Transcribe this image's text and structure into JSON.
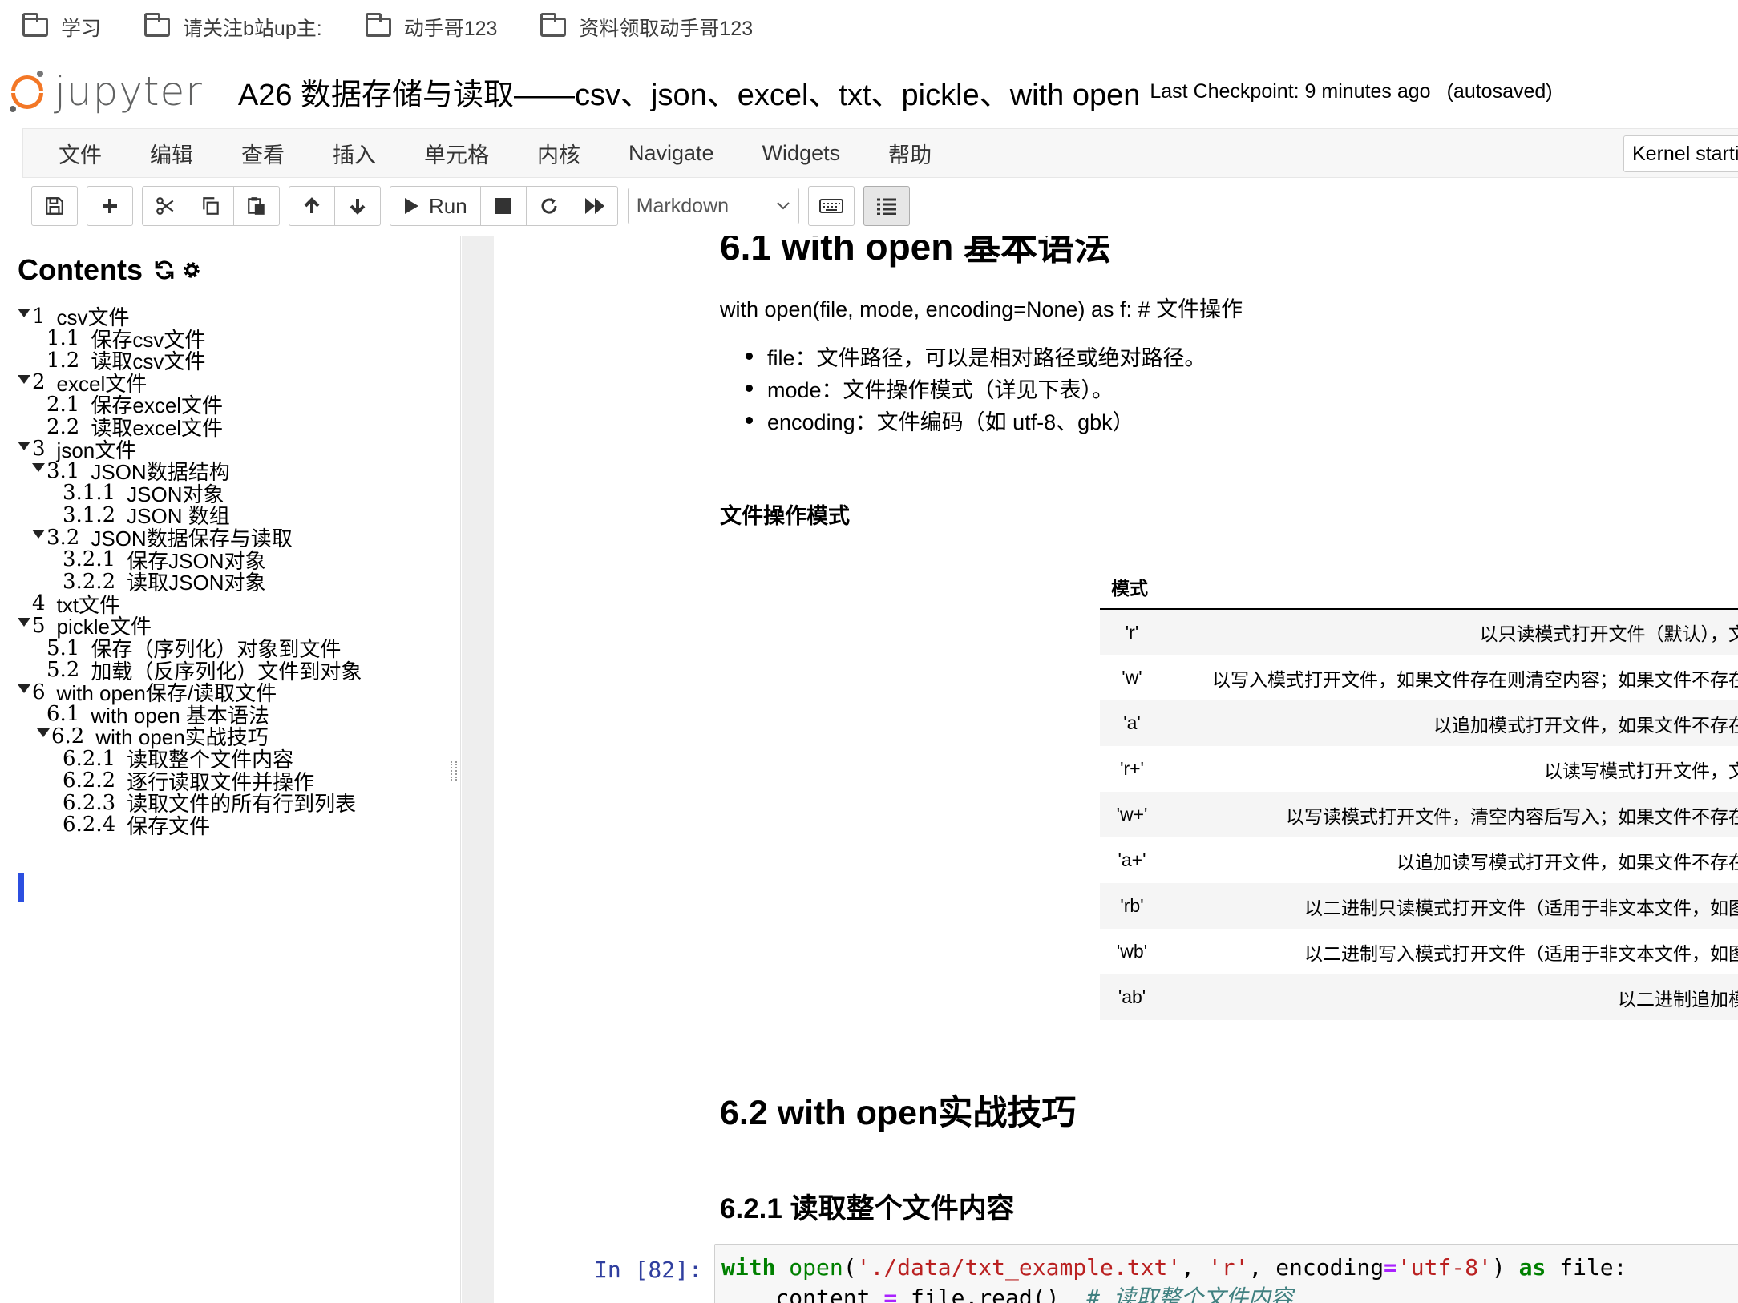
{
  "bookmarks": [
    "学习",
    "请关注b站up主:",
    "动手哥123",
    "资料领取动手哥123"
  ],
  "header": {
    "logo_text": "jupyter",
    "title": "A26 数据存储与读取——csv、json、excel、txt、pickle、with open",
    "checkpoint": "Last Checkpoint: 9 minutes ago",
    "autosaved": "(autosaved)"
  },
  "menu": [
    "文件",
    "编辑",
    "查看",
    "插入",
    "单元格",
    "内核",
    "Navigate",
    "Widgets",
    "帮助"
  ],
  "kernel_status": "Kernel starting",
  "toolbar": {
    "run_label": "Run",
    "cell_type": "Markdown",
    "icons": [
      "save-icon",
      "plus-icon",
      "scissors-icon",
      "copy-icon",
      "paste-icon",
      "arrow-up-icon",
      "arrow-down-icon",
      "play-icon",
      "stop-icon",
      "restart-icon",
      "fast-forward-icon",
      "keyboard-icon",
      "list-icon"
    ]
  },
  "toc": {
    "title": "Contents",
    "items": [
      {
        "num": "1",
        "label": "csv文件",
        "level": 1,
        "collapsible": true
      },
      {
        "num": "1.1",
        "label": "保存csv文件",
        "level": 2,
        "collapsible": false
      },
      {
        "num": "1.2",
        "label": "读取csv文件",
        "level": 2,
        "collapsible": false
      },
      {
        "num": "2",
        "label": "excel文件",
        "level": 1,
        "collapsible": true
      },
      {
        "num": "2.1",
        "label": "保存excel文件",
        "level": 2,
        "collapsible": false
      },
      {
        "num": "2.2",
        "label": "读取excel文件",
        "level": 2,
        "collapsible": false
      },
      {
        "num": "3",
        "label": "json文件",
        "level": 1,
        "collapsible": true
      },
      {
        "num": "3.1",
        "label": "JSON数据结构",
        "level": 2,
        "collapsible": true
      },
      {
        "num": "3.1.1",
        "label": "JSON对象",
        "level": 3,
        "collapsible": false
      },
      {
        "num": "3.1.2",
        "label": "JSON 数组",
        "level": 3,
        "collapsible": false
      },
      {
        "num": "3.2",
        "label": "JSON数据保存与读取",
        "level": 2,
        "collapsible": true
      },
      {
        "num": "3.2.1",
        "label": "保存JSON对象",
        "level": 3,
        "collapsible": false
      },
      {
        "num": "3.2.2",
        "label": "读取JSON对象",
        "level": 3,
        "collapsible": false
      },
      {
        "num": "4",
        "label": "txt文件",
        "level": 1,
        "collapsible": false
      },
      {
        "num": "5",
        "label": "pickle文件",
        "level": 1,
        "collapsible": true
      },
      {
        "num": "5.1",
        "label": "保存（序列化）对象到文件",
        "level": 2,
        "collapsible": false
      },
      {
        "num": "5.2",
        "label": "加载（反序列化）文件到对象",
        "level": 2,
        "collapsible": false
      },
      {
        "num": "6",
        "label": "with open保存/读取文件",
        "level": 1,
        "collapsible": true
      },
      {
        "num": "6.1",
        "label": "with open 基本语法",
        "level": 2,
        "collapsible": false
      },
      {
        "num": "6.2",
        "label": "with open实战技巧",
        "level": 2,
        "collapsible": true,
        "active": true
      },
      {
        "num": "6.2.1",
        "label": "读取整个文件内容",
        "level": 3,
        "collapsible": false
      },
      {
        "num": "6.2.2",
        "label": "逐行读取文件并操作",
        "level": 3,
        "collapsible": false
      },
      {
        "num": "6.2.3",
        "label": "读取文件的所有行到列表",
        "level": 3,
        "collapsible": false
      },
      {
        "num": "6.2.4",
        "label": "保存文件",
        "level": 3,
        "collapsible": false
      }
    ]
  },
  "content": {
    "cut_heading": "6.1  with open 基本语法",
    "syntax": "with open(file, mode, encoding=None) as f: # 文件操作",
    "bullets": [
      "file：文件路径，可以是相对路径或绝对路径。",
      "mode：文件操作模式（详见下表）。",
      "encoding：文件编码（如 utf-8、gbk）"
    ],
    "modes_title": "文件操作模式",
    "table_header": "模式",
    "table_rows": [
      {
        "mode": "'r'",
        "desc": "以只读模式打开文件（默认），文件"
      },
      {
        "mode": "'w'",
        "desc": "以写入模式打开文件，如果文件存在则清空内容；如果文件不存在则"
      },
      {
        "mode": "'a'",
        "desc": "以追加模式打开文件，如果文件不存在则"
      },
      {
        "mode": "'r+'",
        "desc": "以读写模式打开文件，文件"
      },
      {
        "mode": "'w+'",
        "desc": "以写读模式打开文件，清空内容后写入；如果文件不存在则"
      },
      {
        "mode": "'a+'",
        "desc": "以追加读写模式打开文件，如果文件不存在则"
      },
      {
        "mode": "'rb'",
        "desc": "以二进制只读模式打开文件（适用于非文本文件，如图片"
      },
      {
        "mode": "'wb'",
        "desc": "以二进制写入模式打开文件（适用于非文本文件，如图片"
      },
      {
        "mode": "'ab'",
        "desc": "以二进制追加模式"
      }
    ],
    "h2": "6.2  with open实战技巧",
    "h3": "6.2.1  读取整个文件内容",
    "prompt": "In [82]:",
    "code": {
      "kw_with": "with",
      "fn_open": "open",
      "arg_path": "'./data/txt_example.txt'",
      "arg_mode": "'r'",
      "kwarg": "encoding",
      "arg_enc": "'utf-8'",
      "kw_as": "as",
      "var_file": "file:",
      "line2_var": "content",
      "line2_call": "file.read()",
      "line2_comment": "# 读取整个文件内容"
    }
  }
}
